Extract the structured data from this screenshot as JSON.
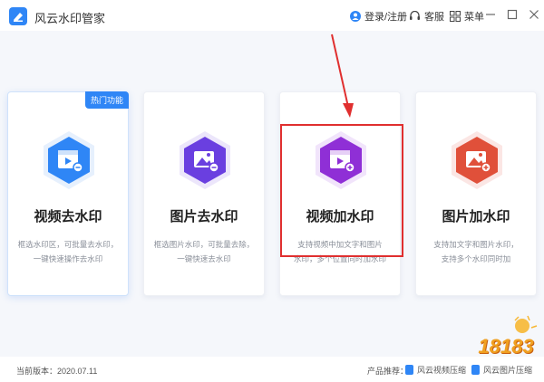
{
  "app": {
    "title": "风云水印管家"
  },
  "topbar": {
    "login_label": "登录/注册",
    "service_label": "客服",
    "menu_label": "菜单"
  },
  "cards": [
    {
      "title": "视频去水印",
      "desc_line1": "框选水印区，可批量去水印，",
      "desc_line2": "一键快速操作去水印",
      "badge": "热门功能",
      "icon": "video-remove-icon",
      "accent": "#2f86f6"
    },
    {
      "title": "图片去水印",
      "desc_line1": "框选图片水印，可批量去除，",
      "desc_line2": "一键快速去水印",
      "icon": "image-remove-icon",
      "accent": "#6a3fe0"
    },
    {
      "title": "视频加水印",
      "desc_line1": "支持视频中加文字和图片",
      "desc_line2": "水印，多个位置同时加水印",
      "icon": "video-add-icon",
      "accent": "#8f2fd6"
    },
    {
      "title": "图片加水印",
      "desc_line1": "支持加文字和图片水印，",
      "desc_line2": "支持多个水印同时加",
      "icon": "image-add-icon",
      "accent": "#e0503a"
    }
  ],
  "footer": {
    "version": "当前版本：2020.07.11",
    "recommend_label": "产品推荐：",
    "rec1": "风云视频压缩",
    "rec2": "风云图片压缩"
  },
  "watermark": {
    "text": "18183"
  }
}
